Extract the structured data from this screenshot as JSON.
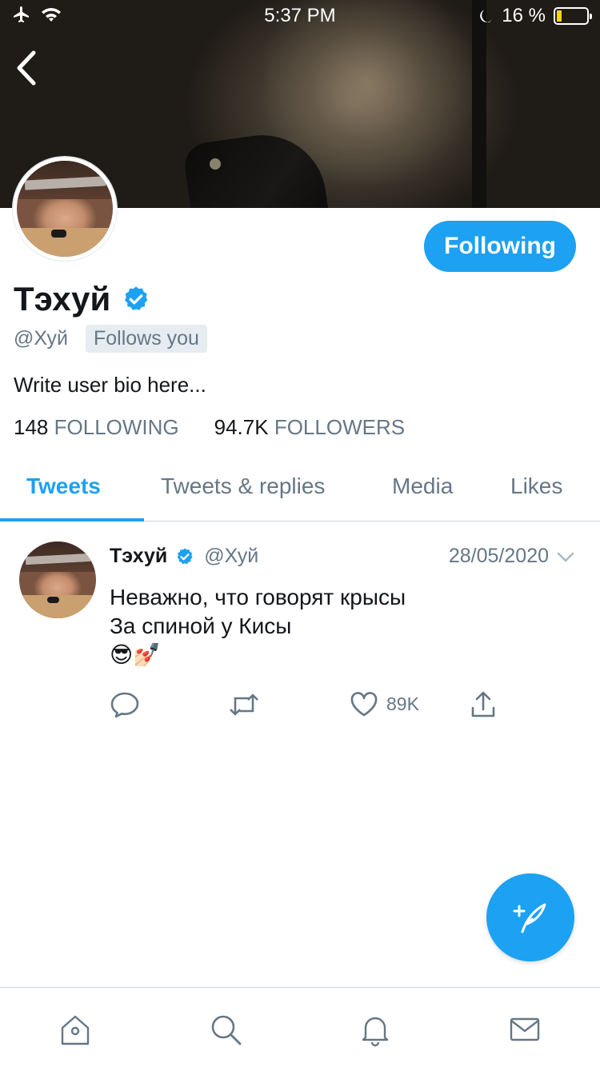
{
  "status_bar": {
    "time": "5:37 PM",
    "battery_percent": "16 %",
    "battery_level": 0.16
  },
  "profile": {
    "name": "Тэхуй",
    "handle": "@Хуй",
    "follows_you_label": "Follows you",
    "bio": "Write user bio here...",
    "following_count": "148",
    "following_label": "FOLLOWING",
    "followers_count": "94.7K",
    "followers_label": "FOLLOWERS",
    "follow_button_label": "Following"
  },
  "tabs": [
    {
      "label": "Tweets",
      "active": true
    },
    {
      "label": "Tweets & replies",
      "active": false
    },
    {
      "label": "Media",
      "active": false
    },
    {
      "label": "Likes",
      "active": false
    }
  ],
  "tweet": {
    "author_name": "Тэхуй",
    "author_handle": "@Хуй",
    "date": "28/05/2020",
    "lines": [
      "Неважно, что говорят крысы",
      "За спиной у Кисы",
      "😎💅🏻"
    ],
    "likes": "89K"
  },
  "icons": {
    "back": "chevron-left-icon",
    "verified": "verified-badge-icon",
    "reply": "reply-icon",
    "retweet": "retweet-icon",
    "like": "heart-icon",
    "share": "share-icon",
    "compose": "compose-tweet-icon",
    "home": "home-icon",
    "search": "search-icon",
    "notifications": "bell-icon",
    "messages": "envelope-icon"
  },
  "colors": {
    "accent": "#1da1f2",
    "secondary_text": "#657786",
    "primary_text": "#14171a"
  }
}
